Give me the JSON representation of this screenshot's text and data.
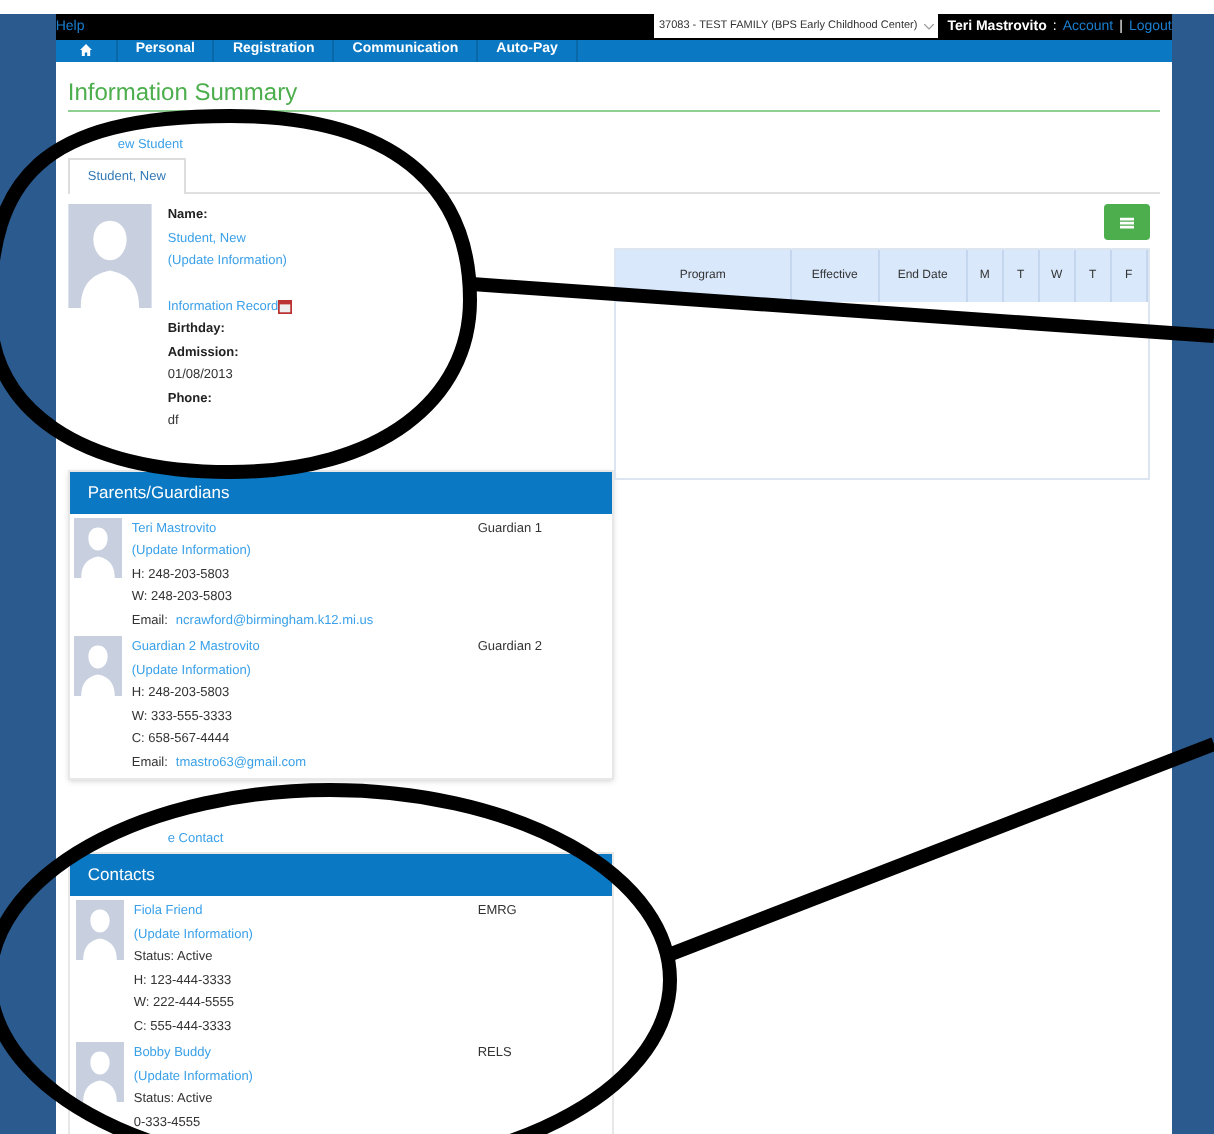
{
  "top_bar": {
    "help": "Help",
    "family_select": "37083 - TEST FAMILY (BPS Early Childhood Center)",
    "user": "Teri Mastrovito",
    "separator": ":",
    "account": "Account",
    "divider": "|",
    "logout": "Logout"
  },
  "nav": [
    {
      "label": "Personal"
    },
    {
      "label": "Registration"
    },
    {
      "label": "Communication"
    },
    {
      "label": "Auto-Pay"
    }
  ],
  "page_title": "Information Summary",
  "add_student_link": "ew Student",
  "student_tabs": [
    {
      "label": "Student, New",
      "selected": true
    }
  ],
  "student": {
    "name_label": "Name:",
    "name": "Student, New",
    "update": "(Update Information)",
    "record_link": "Information Record",
    "birthday_label": "Birthday:",
    "admission_label": "Admission:",
    "admission": "01/08/2013",
    "phone_label": "Phone:",
    "phone": "df"
  },
  "schedule_table": {
    "columns": [
      "Program",
      "Effective",
      "End Date",
      "M",
      "T",
      "W",
      "T",
      "F"
    ]
  },
  "parents": {
    "title": "Parents/Guardians",
    "items": [
      {
        "name": "Teri Mastrovito",
        "update": "(Update Information)",
        "role": "Guardian 1",
        "lines": [
          "H: 248-203-5803",
          "W: 248-203-5803"
        ],
        "email_label": "Email:",
        "email": "ncrawford@birmingham.k12.mi.us"
      },
      {
        "name": "Guardian 2 Mastrovito",
        "update": "(Update Information)",
        "role": "Guardian 2",
        "lines": [
          "H: 248-203-5803",
          "W: 333-555-3333",
          "C: 658-567-4444"
        ],
        "email_label": "Email:",
        "email": "tmastro63@gmail.com"
      }
    ]
  },
  "add_contact_link": "e Contact",
  "contacts": {
    "title": "Contacts",
    "items": [
      {
        "name": "Fiola Friend",
        "update": "(Update Information)",
        "role": "EMRG",
        "lines": [
          "Status: Active",
          "H: 123-444-3333",
          "W: 222-444-5555",
          "C: 555-444-3333"
        ]
      },
      {
        "name": "Bobby Buddy",
        "update": "(Update Information)",
        "role": "RELS",
        "lines": [
          "Status: Active",
          "0-333-4555"
        ]
      }
    ]
  }
}
